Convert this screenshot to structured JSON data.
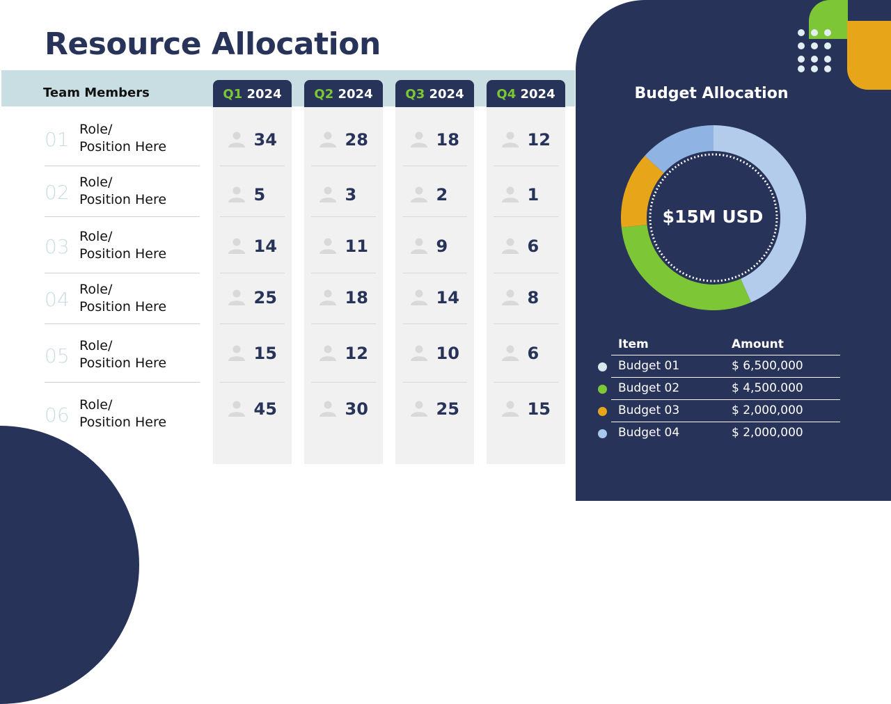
{
  "title": "Resource Allocation",
  "table": {
    "team_header": "Team Members",
    "quarters": [
      {
        "q": "Q1",
        "year": "2024"
      },
      {
        "q": "Q2",
        "year": "2024"
      },
      {
        "q": "Q3",
        "year": "2024"
      },
      {
        "q": "Q4",
        "year": "2024"
      }
    ],
    "rows": [
      {
        "index": "01",
        "role_line1": "Role/",
        "role_line2": "Position Here",
        "values": [
          "34",
          "28",
          "18",
          "12"
        ]
      },
      {
        "index": "02",
        "role_line1": "Role/",
        "role_line2": "Position Here",
        "values": [
          "5",
          "3",
          "2",
          "1"
        ]
      },
      {
        "index": "03",
        "role_line1": "Role/",
        "role_line2": "Position Here",
        "values": [
          "14",
          "11",
          "9",
          "6"
        ]
      },
      {
        "index": "04",
        "role_line1": "Role/",
        "role_line2": "Position Here",
        "values": [
          "25",
          "18",
          "14",
          "8"
        ]
      },
      {
        "index": "05",
        "role_line1": "Role/",
        "role_line2": "Position Here",
        "values": [
          "15",
          "12",
          "10",
          "6"
        ]
      },
      {
        "index": "06",
        "role_line1": "Role/",
        "role_line2": "Position Here",
        "values": [
          "45",
          "30",
          "25",
          "15"
        ]
      }
    ],
    "icon": "person-icon"
  },
  "budget": {
    "title": "Budget Allocation",
    "center_label": "$15M USD",
    "table_headers": {
      "item": "Item",
      "amount": "Amount"
    },
    "items": [
      {
        "item": "Budget 01",
        "amount": "$ 6,500,000",
        "color": "#b4ccec"
      },
      {
        "item": "Budget 02",
        "amount": "$ 4,500.000",
        "color": "#7dc636"
      },
      {
        "item": "Budget 03",
        "amount": "$ 2,000,000",
        "color": "#e7a61a"
      },
      {
        "item": "Budget 04",
        "amount": "$ 2,000,000",
        "color": "#8fb4e3"
      }
    ],
    "legend_dot_colors": [
      "#dce6ee",
      "#7dc636",
      "#e7a61a",
      "#a9c8ef"
    ]
  },
  "chart_data": {
    "type": "pie",
    "title": "Budget Allocation",
    "center_label": "$15M USD",
    "categories": [
      "Budget 01",
      "Budget 02",
      "Budget 03",
      "Budget 04"
    ],
    "values": [
      6500000,
      4500000,
      2000000,
      2000000
    ],
    "colors": [
      "#b4ccec",
      "#7dc636",
      "#e7a61a",
      "#8fb4e3"
    ],
    "donut": true
  },
  "colors": {
    "navy": "#28335a",
    "green": "#7dc636",
    "orange": "#e7a61a",
    "header_band": "#c9dee2"
  }
}
